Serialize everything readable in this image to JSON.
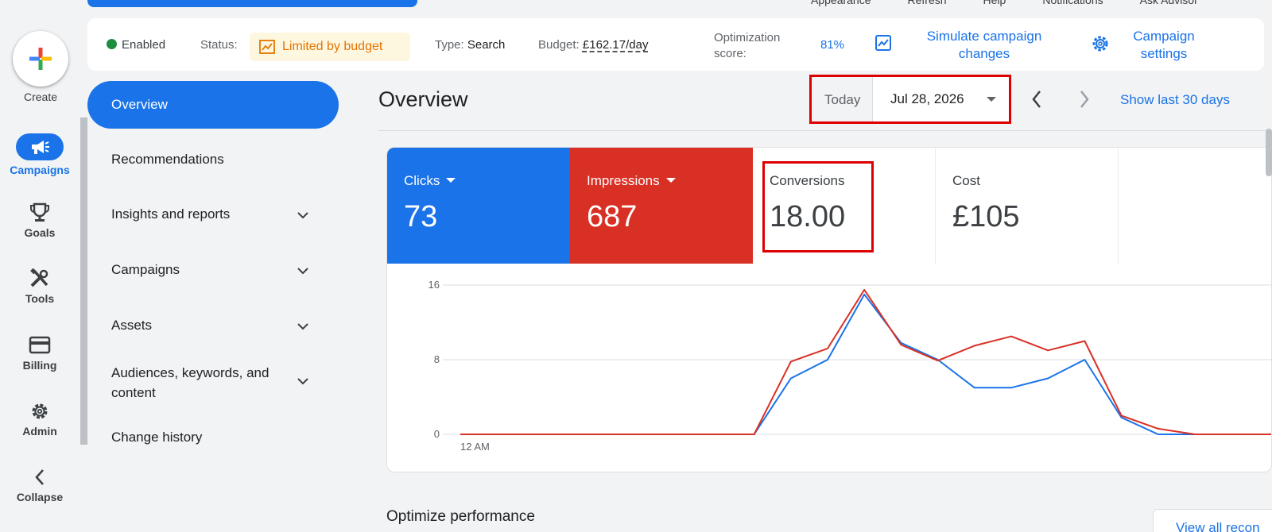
{
  "top_menu": [
    "Appearance",
    "Refresh",
    "Help",
    "Notifications",
    "Ask Advisor"
  ],
  "rail": {
    "create": "Create",
    "items": [
      {
        "label": "Campaigns",
        "icon": "megaphone-icon",
        "active": true
      },
      {
        "label": "Goals",
        "icon": "trophy-icon"
      },
      {
        "label": "Tools",
        "icon": "tools-icon"
      },
      {
        "label": "Billing",
        "icon": "credit-card-icon"
      },
      {
        "label": "Admin",
        "icon": "gear-icon"
      }
    ],
    "collapse": "Collapse"
  },
  "status_bar": {
    "enabled": "Enabled",
    "status_label": "Status:",
    "status_value": "Limited by budget",
    "type_label": "Type:",
    "type_value": "Search",
    "budget_label": "Budget:",
    "budget_value": "£162.17/day",
    "opt_label_1": "Optimization",
    "opt_label_2": "score:",
    "opt_value": "81%",
    "simulate_1": "Simulate campaign",
    "simulate_2": "changes",
    "settings_1": "Campaign",
    "settings_2": "settings"
  },
  "nav": {
    "items": [
      "Overview",
      "Recommendations",
      "Insights and reports",
      "Campaigns",
      "Assets",
      "Audiences, keywords, and",
      "content",
      "Change history"
    ]
  },
  "header": {
    "title": "Overview",
    "today": "Today",
    "date": "Jul 28, 2026",
    "show_last": "Show last 30 days"
  },
  "tiles": {
    "clicks_label": "Clicks",
    "clicks_value": "73",
    "impr_label": "Impressions",
    "impr_value": "687",
    "conv_label": "Conversions",
    "conv_value": "18.00",
    "cost_label": "Cost",
    "cost_value": "£105"
  },
  "chart_data": {
    "type": "line",
    "y_ticks": [
      "16",
      "8",
      "0"
    ],
    "ylim": [
      0,
      16
    ],
    "xlabel_first": "12 AM",
    "series": [
      {
        "color": "#1a73e8",
        "values": [
          0,
          0,
          0,
          0,
          0,
          0,
          0,
          0,
          0,
          6,
          8,
          15,
          9.8,
          8,
          5,
          5,
          6,
          8,
          1.8,
          0,
          0,
          0,
          0,
          0
        ]
      },
      {
        "color": "#d93025",
        "values": [
          0,
          0,
          0,
          0,
          0,
          0,
          0,
          0,
          0,
          7.8,
          9.2,
          15.5,
          9.6,
          7.9,
          9.5,
          10.5,
          9,
          10,
          2,
          0.6,
          0,
          0,
          0,
          0
        ]
      }
    ]
  },
  "footer": {
    "optimize": "Optimize performance",
    "view_all": "View all recon"
  }
}
